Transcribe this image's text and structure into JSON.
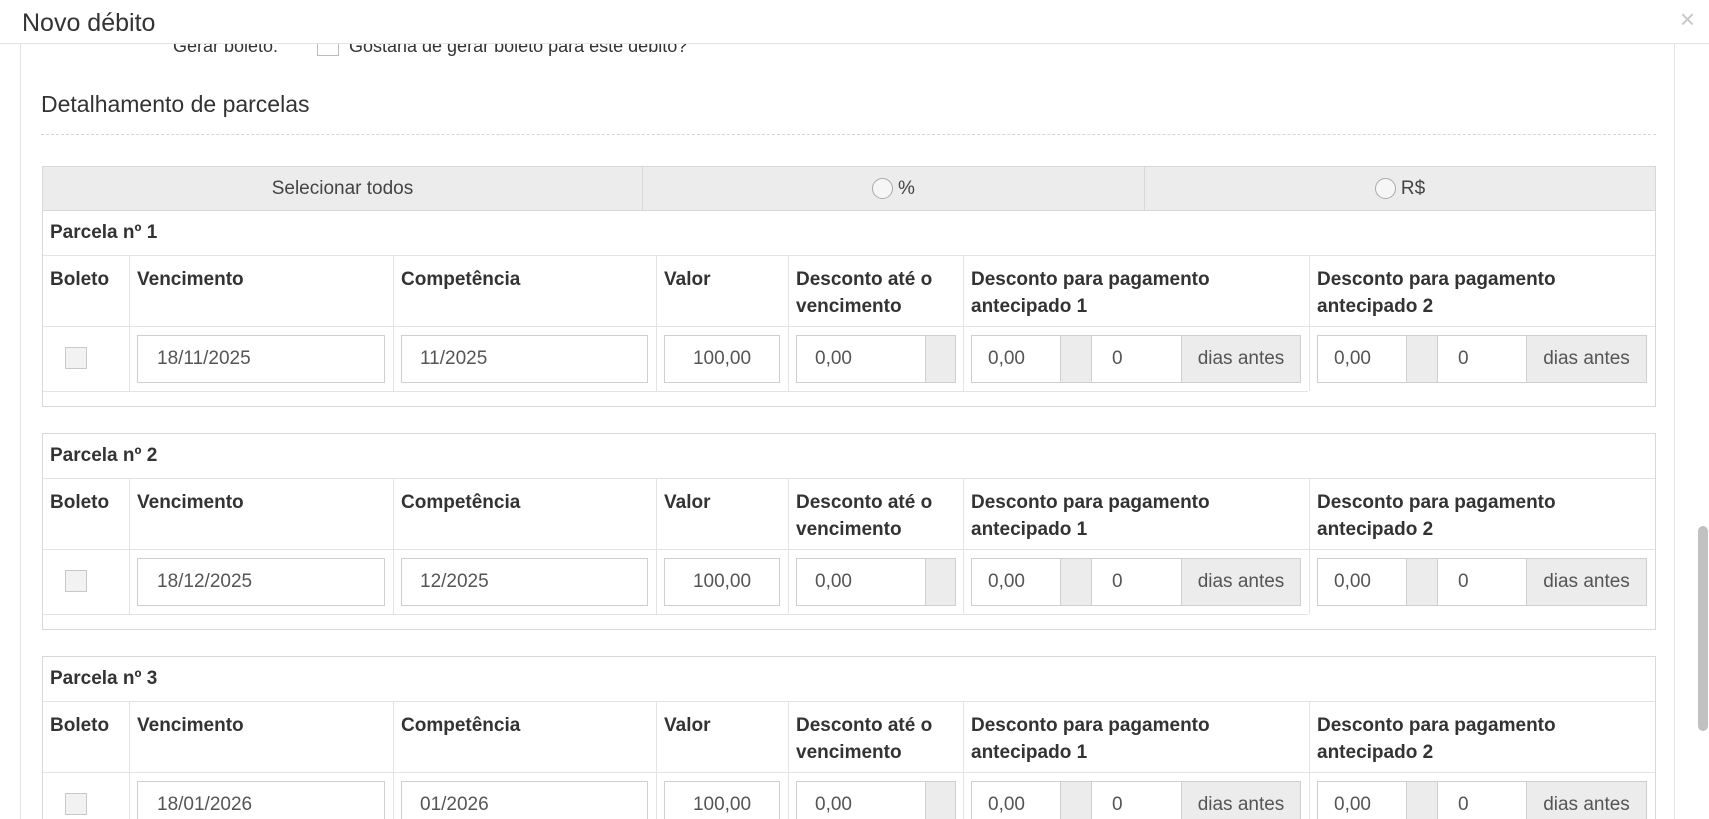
{
  "modal": {
    "title": "Novo débito",
    "close_glyph": "×"
  },
  "boleto_row": {
    "label": "Gerar boleto:",
    "checkbox_text": "Gostaria de gerar boleto para este débito?"
  },
  "section": {
    "title": "Detalhamento de parcelas"
  },
  "select_bar": {
    "select_all": "Selecionar todos",
    "percent_label": "%",
    "real_label": "R$"
  },
  "columns": {
    "boleto": "Boleto",
    "vencimento": "Vencimento",
    "competencia": "Competência",
    "valor": "Valor",
    "desconto_ate_1": "Desconto até o",
    "desconto_ate_2": "vencimento",
    "antecipado1_1": "Desconto para pagamento",
    "antecipado1_2": "antecipado 1",
    "antecipado2_1": "Desconto para pagamento",
    "antecipado2_2": "antecipado 2"
  },
  "dias_antes": "dias antes",
  "parcelas": [
    {
      "title": "Parcela nº 1",
      "vencimento": "18/11/2025",
      "competencia": "11/2025",
      "valor": "100,00",
      "desconto_venc": "0,00",
      "antecipado1_valor": "0,00",
      "antecipado1_dias": "0",
      "antecipado2_valor": "0,00",
      "antecipado2_dias": "0"
    },
    {
      "title": "Parcela nº 2",
      "vencimento": "18/12/2025",
      "competencia": "12/2025",
      "valor": "100,00",
      "desconto_venc": "0,00",
      "antecipado1_valor": "0,00",
      "antecipado1_dias": "0",
      "antecipado2_valor": "0,00",
      "antecipado2_dias": "0"
    },
    {
      "title": "Parcela nº 3",
      "vencimento": "18/01/2026",
      "competencia": "01/2026",
      "valor": "100,00",
      "desconto_venc": "0,00",
      "antecipado1_valor": "0,00",
      "antecipado1_dias": "0",
      "antecipado2_valor": "0,00",
      "antecipado2_dias": "0"
    }
  ]
}
